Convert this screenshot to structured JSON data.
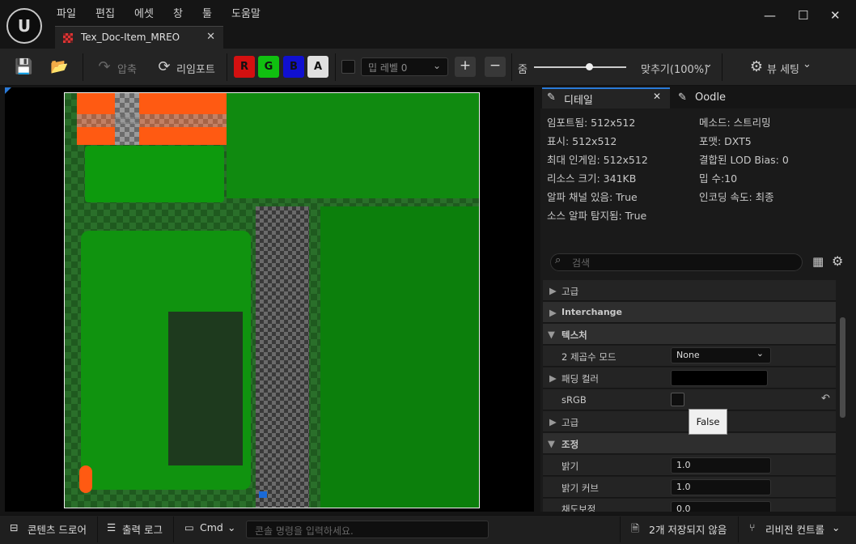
{
  "menu": [
    "파일",
    "편집",
    "에셋",
    "창",
    "툴",
    "도움말"
  ],
  "tab": {
    "title": "Tex_Doc-Item_MREO"
  },
  "toolbar": {
    "compress": "압축",
    "reimport": "리임포트",
    "channels": [
      "R",
      "G",
      "B",
      "A"
    ],
    "channel_colors": [
      "#d41010",
      "#10c010",
      "#1010d0",
      "#e0e0e0"
    ],
    "mip_placeholder": "밉 레벨 0",
    "zoom_label": "줌",
    "fit_label": "맞추기(100%)",
    "view_settings": "뷰 세팅"
  },
  "details": {
    "tab_details": "디테일",
    "tab_oodle": "Oodle",
    "info_left": [
      "임포트됨: 512x512",
      "표시: 512x512",
      "최대 인게임: 512x512",
      "리소스 크기: 341KB",
      "알파 채널 있음: True",
      "소스 알파 탐지됨: True"
    ],
    "info_right": [
      "메소드: 스트리밍",
      "포맷: DXT5",
      "결합된 LOD Bias: 0",
      "밉 수:10",
      "인코딩 속도: 최종"
    ],
    "search_placeholder": "검색",
    "rows": [
      {
        "label": "고급",
        "kind": "sub"
      },
      {
        "label": "Interchange",
        "kind": "cat"
      },
      {
        "label": "텍스처",
        "kind": "cat-open"
      },
      {
        "label": "2 제곱수 모드",
        "kind": "prop",
        "value": "None"
      },
      {
        "label": "패딩 컬러",
        "kind": "prop-sub",
        "value": ""
      },
      {
        "label": "sRGB",
        "kind": "prop",
        "value": ""
      },
      {
        "label": "고급",
        "kind": "sub"
      },
      {
        "label": "조정",
        "kind": "cat-open"
      },
      {
        "label": "밝기",
        "kind": "prop",
        "value": "1.0"
      },
      {
        "label": "밝기 커브",
        "kind": "prop",
        "value": "1.0"
      },
      {
        "label": "채도보정",
        "kind": "prop",
        "value": "0.0"
      }
    ],
    "tooltip": "False"
  },
  "status": {
    "content_drawer": "콘텐츠 드로어",
    "output_log": "출력 로그",
    "cmd": "Cmd",
    "console_placeholder": "콘솔 명령을 입력하세요.",
    "unsaved": "2개 저장되지 않음",
    "revision": "리비전 컨트롤"
  }
}
